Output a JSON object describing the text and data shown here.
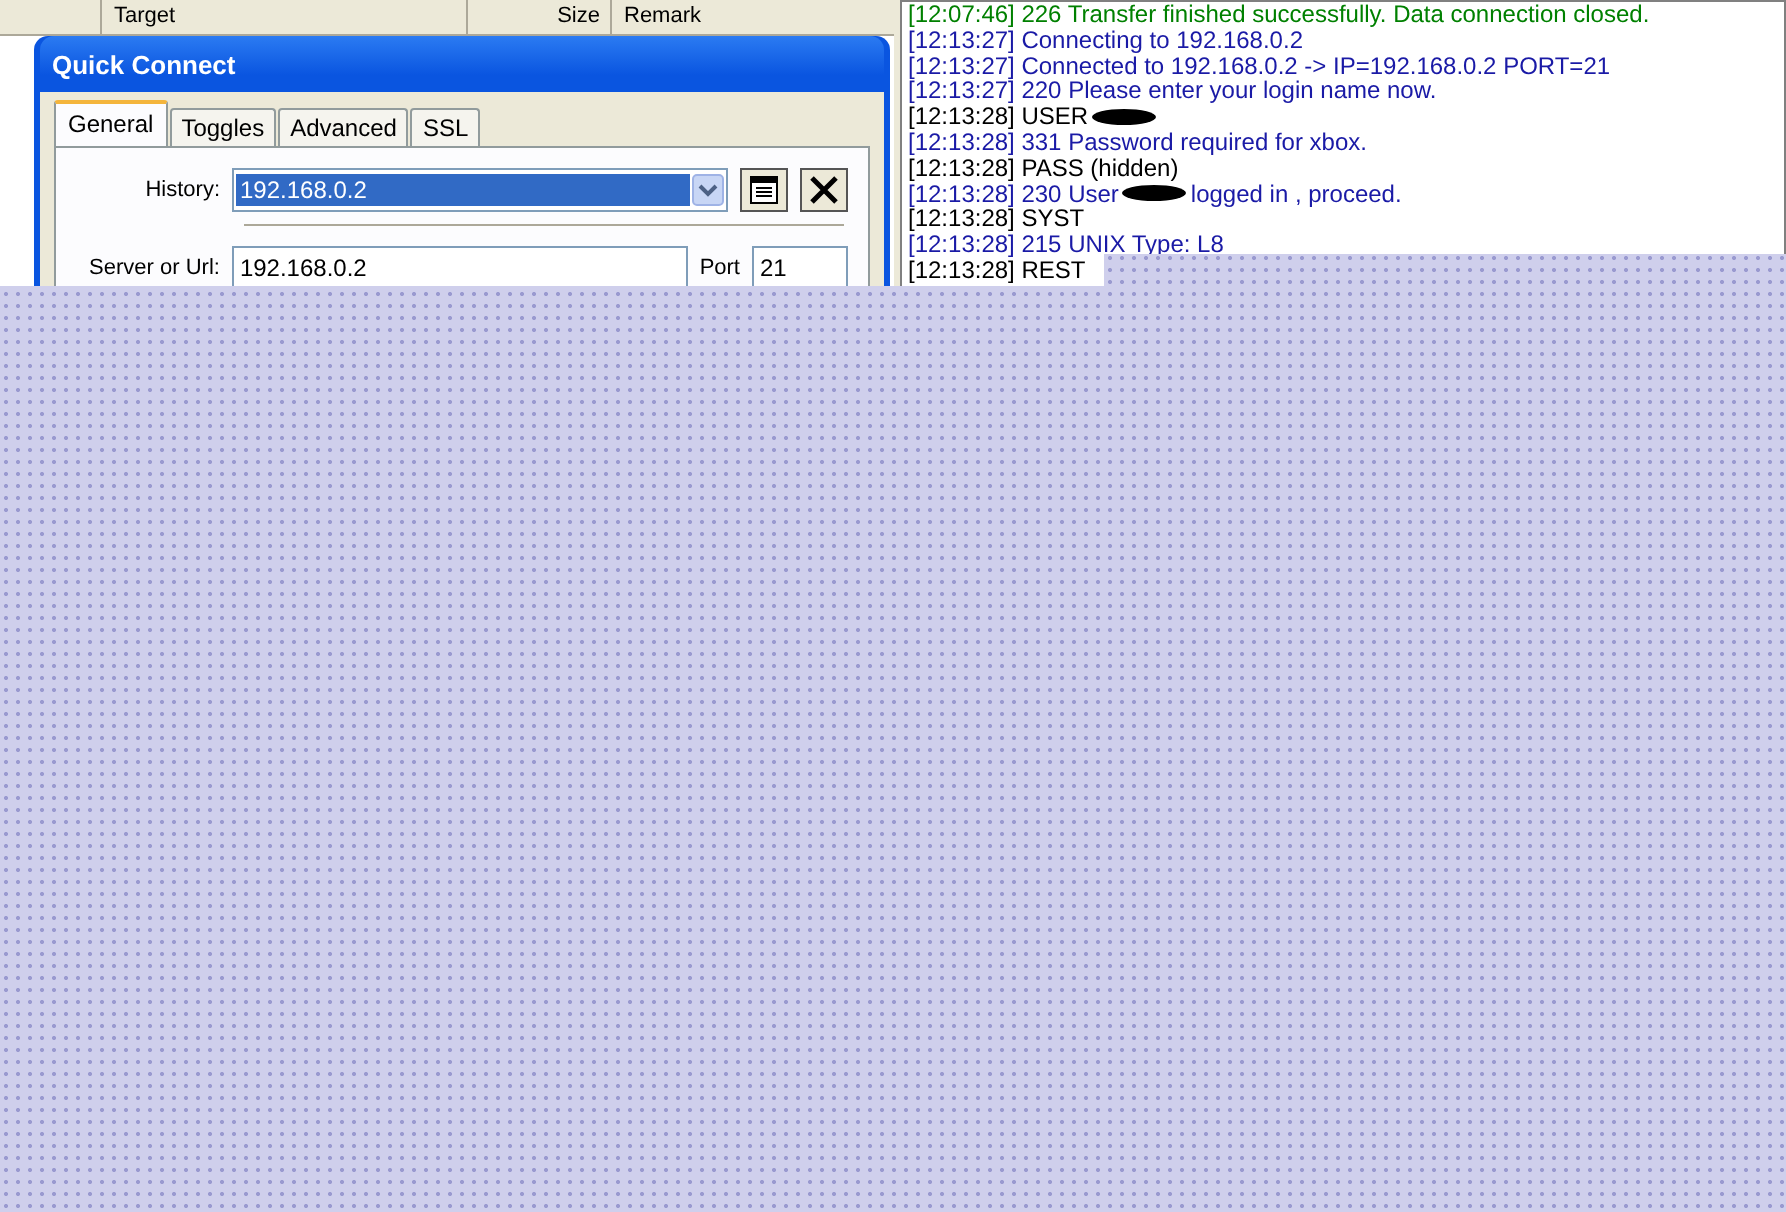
{
  "file_list": {
    "columns": [
      "Target",
      "Size",
      "Remark"
    ]
  },
  "dialog": {
    "title": "Quick Connect",
    "tabs": [
      {
        "label": "General",
        "selected": true
      },
      {
        "label": "Toggles",
        "selected": false
      },
      {
        "label": "Advanced",
        "selected": false
      },
      {
        "label": "SSL",
        "selected": false
      }
    ],
    "history": {
      "label": "History:",
      "value": "192.168.0.2"
    },
    "server": {
      "label": "Server or Url:",
      "value": "192.168.0.2"
    },
    "port": {
      "label": "Port",
      "value": "21"
    }
  },
  "log": [
    {
      "kind": "success",
      "text": "[12:07:46] 226 Transfer finished successfully. Data connection closed."
    },
    {
      "kind": "reply",
      "text": "[12:13:27] Connecting to 192.168.0.2"
    },
    {
      "kind": "reply",
      "text": "[12:13:27] Connected to 192.168.0.2 -> IP=192.168.0.2 PORT=21"
    },
    {
      "kind": "reply",
      "text": "[12:13:27] 220 Please enter your login name now."
    },
    {
      "kind": "command",
      "text": "[12:13:28] USER",
      "redacted": true
    },
    {
      "kind": "reply",
      "text": "[12:13:28] 331 Password required for xbox."
    },
    {
      "kind": "command",
      "text": "[12:13:28] PASS (hidden)"
    },
    {
      "kind": "reply",
      "text": "[12:13:28] 230 User",
      "redacted": true,
      "after": "logged in , proceed."
    },
    {
      "kind": "command",
      "text": "[12:13:28] SYST"
    },
    {
      "kind": "reply",
      "text": "[12:13:28] 215 UNIX Type: L8"
    },
    {
      "kind": "command",
      "text": "[12:13:28] REST"
    }
  ]
}
